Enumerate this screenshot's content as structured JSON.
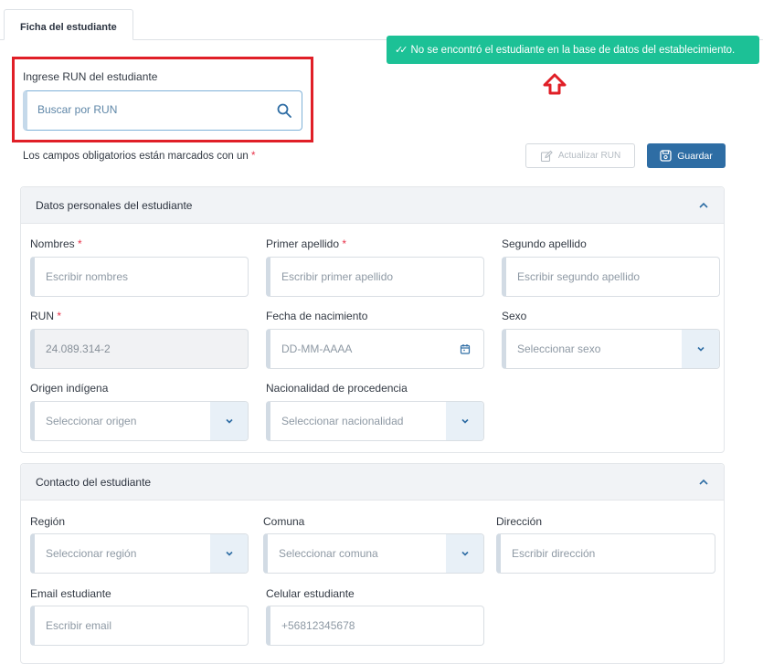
{
  "tab": {
    "label": "Ficha del estudiante"
  },
  "toast": {
    "message": "No se encontró el estudiante en la base de datos del establecimiento.",
    "color": "#1cc196"
  },
  "run_search": {
    "label": "Ingrese RUN del estudiante",
    "placeholder": "Buscar por RUN"
  },
  "required_note": {
    "text": "Los campos obligatorios están marcados con un",
    "mark": "*"
  },
  "buttons": {
    "update_run": "Actualizar RUN",
    "save": "Guardar",
    "save_color": "#2e6da4"
  },
  "personal": {
    "title": "Datos personales del estudiante",
    "nombres": {
      "label": "Nombres",
      "placeholder": "Escribir nombres"
    },
    "primer_apellido": {
      "label": "Primer apellido",
      "placeholder": "Escribir primer apellido"
    },
    "segundo_apellido": {
      "label": "Segundo apellido",
      "placeholder": "Escribir segundo apellido"
    },
    "run": {
      "label": "RUN",
      "value": "24.089.314-2"
    },
    "fecha_nacimiento": {
      "label": "Fecha de nacimiento",
      "placeholder": "DD-MM-AAAA"
    },
    "sexo": {
      "label": "Sexo",
      "placeholder": "Seleccionar sexo"
    },
    "origen": {
      "label": "Origen indígena",
      "placeholder": "Seleccionar origen"
    },
    "nacionalidad": {
      "label": "Nacionalidad de procedencia",
      "placeholder": "Seleccionar nacionalidad"
    }
  },
  "contact": {
    "title": "Contacto del estudiante",
    "region": {
      "label": "Región",
      "placeholder": "Seleccionar región"
    },
    "comuna": {
      "label": "Comuna",
      "placeholder": "Seleccionar comuna"
    },
    "direccion": {
      "label": "Dirección",
      "placeholder": "Escribir dirección"
    },
    "email": {
      "label": "Email estudiante",
      "placeholder": "Escribir email"
    },
    "celular": {
      "label": "Celular estudiante",
      "placeholder": "+56812345678"
    }
  },
  "required_color": "#e8334a",
  "icons": [
    "double-check-icon",
    "red-up-arrow-icon",
    "search-icon",
    "edit-icon",
    "save-icon",
    "chevron-up-icon",
    "calendar-icon",
    "chevron-down-icon"
  ]
}
